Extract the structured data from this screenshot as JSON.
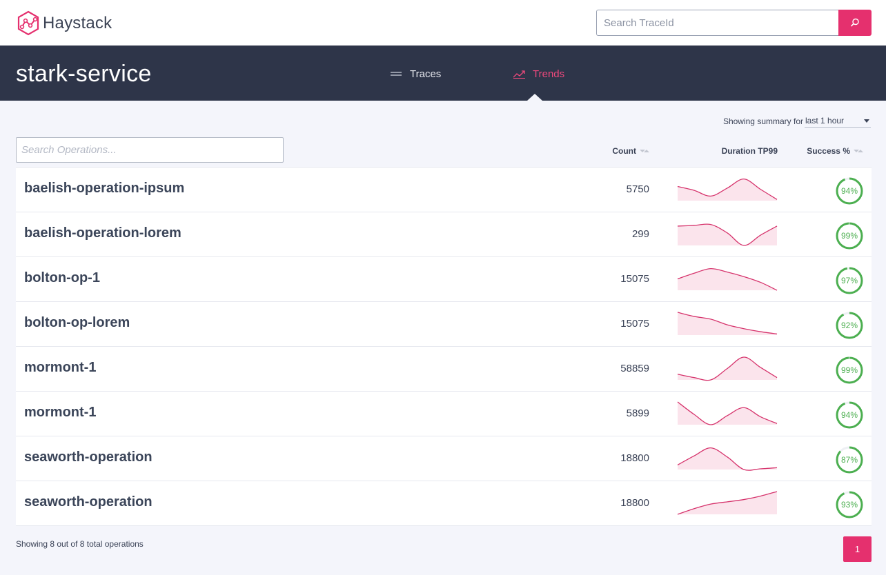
{
  "app": {
    "name": "Haystack",
    "logo_icon": "haystack-logo-icon"
  },
  "search": {
    "placeholder": "Search TraceId",
    "button_icon": "search-icon"
  },
  "service": {
    "name": "stark-service"
  },
  "tabs": [
    {
      "label": "Traces",
      "icon": "list-lines-icon",
      "active": false
    },
    {
      "label": "Trends",
      "icon": "trend-line-icon",
      "active": true
    }
  ],
  "summary": {
    "prefix": "Showing summary for",
    "range": "last 1 hour"
  },
  "operations_search": {
    "placeholder": "Search Operations..."
  },
  "columns": {
    "count": "Count",
    "duration": "Duration TP99",
    "success": "Success %"
  },
  "colors": {
    "accent": "#e5306e",
    "header": "#2e3549",
    "success": "#4caf50",
    "spark_line": "#d6336c",
    "spark_fill": "#fbe4ec"
  },
  "rows": [
    {
      "name": "baelish-operation-ipsum",
      "count": "5750",
      "success": 94,
      "success_label": "94%",
      "trend": [
        0.62,
        0.45,
        0.2,
        0.55,
        0.95,
        0.5,
        0.05
      ]
    },
    {
      "name": "baelish-operation-lorem",
      "count": "299",
      "success": 99,
      "success_label": "99%",
      "trend": [
        0.85,
        0.88,
        0.92,
        0.55,
        0.0,
        0.45,
        0.85
      ]
    },
    {
      "name": "bolton-op-1",
      "count": "15075",
      "success": 97,
      "success_label": "97%",
      "trend": [
        0.5,
        0.75,
        0.95,
        0.8,
        0.6,
        0.35,
        0.0
      ]
    },
    {
      "name": "bolton-op-lorem",
      "count": "15075",
      "success": 92,
      "success_label": "92%",
      "trend": [
        1.0,
        0.82,
        0.7,
        0.45,
        0.28,
        0.15,
        0.05
      ]
    },
    {
      "name": "mormont-1",
      "count": "58859",
      "success": 99,
      "success_label": "99%",
      "trend": [
        0.25,
        0.1,
        0.0,
        0.5,
        1.0,
        0.55,
        0.1
      ]
    },
    {
      "name": "mormont-1",
      "count": "5899",
      "success": 94,
      "success_label": "94%",
      "trend": [
        1.0,
        0.45,
        0.0,
        0.4,
        0.75,
        0.35,
        0.05
      ]
    },
    {
      "name": "seaworth-operation",
      "count": "18800",
      "success": 87,
      "success_label": "87%",
      "trend": [
        0.2,
        0.6,
        0.95,
        0.55,
        0.0,
        0.03,
        0.08
      ]
    },
    {
      "name": "seaworth-operation",
      "count": "18800",
      "success": 93,
      "success_label": "93%",
      "trend": [
        0.0,
        0.25,
        0.45,
        0.55,
        0.65,
        0.8,
        1.0
      ]
    }
  ],
  "footer": {
    "showing": "Showing 8 out of 8 total operations"
  },
  "pagination": {
    "current": "1"
  }
}
